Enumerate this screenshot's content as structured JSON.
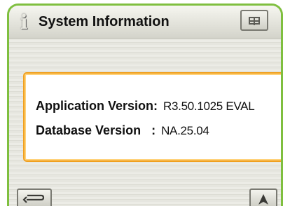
{
  "header": {
    "title": "System Information",
    "info_icon": "info-icon",
    "grid_icon": "grid-icon"
  },
  "details": {
    "app_version_label": "Application Version:",
    "app_version_value": "R3.50.1025 EVAL",
    "db_version_label": "Database Version   :",
    "db_version_value": "NA.25.04"
  },
  "footer": {
    "back_icon": "return-arrow-icon",
    "nav_icon": "navigation-arrow-icon"
  },
  "colors": {
    "frame_accent": "#7fbf3f",
    "panel_border": "#f0a020"
  }
}
